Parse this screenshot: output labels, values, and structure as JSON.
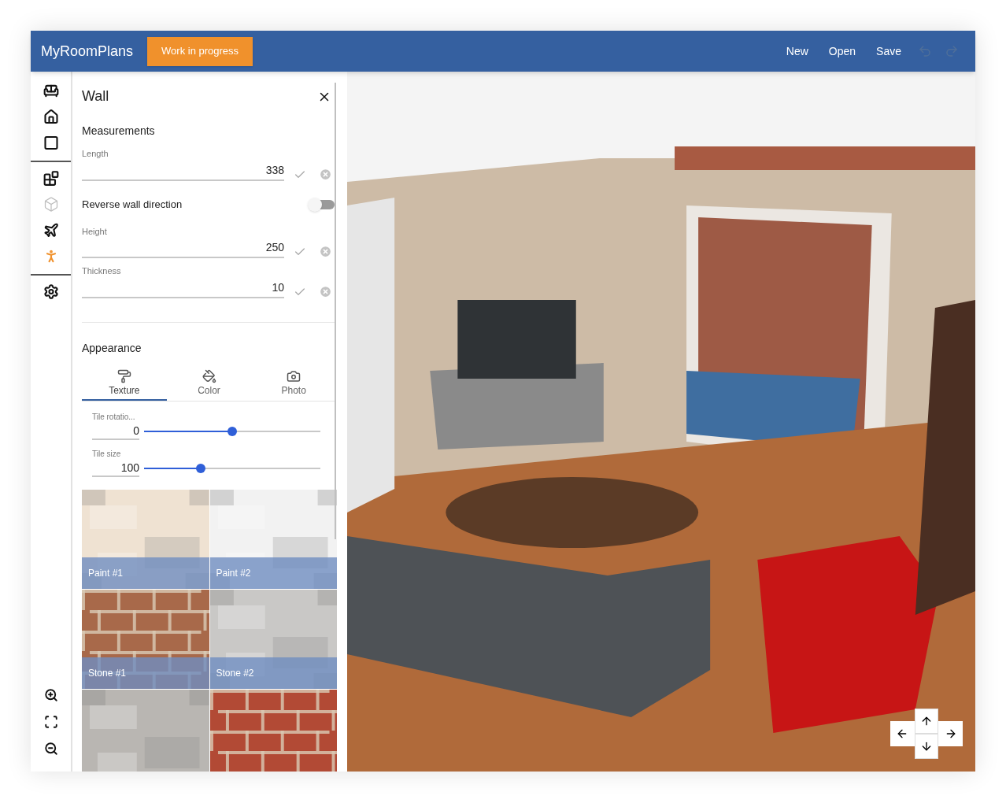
{
  "header": {
    "app_title": "MyRoomPlans",
    "status_badge": "Work in progress",
    "menu": [
      "New",
      "Open",
      "Save"
    ],
    "history": [
      {
        "kind": "undo",
        "disabled": true
      },
      {
        "kind": "redo",
        "disabled": true
      }
    ]
  },
  "rail": {
    "groups": [
      [
        {
          "kind": "sofa",
          "selected": false,
          "disabled": false
        },
        {
          "kind": "home",
          "selected": false,
          "disabled": false
        },
        {
          "kind": "square",
          "selected": false,
          "disabled": false
        }
      ],
      [
        {
          "kind": "blocks",
          "selected": false,
          "disabled": false
        },
        {
          "kind": "cube",
          "selected": false,
          "disabled": true
        },
        {
          "kind": "plane",
          "selected": false,
          "disabled": false
        },
        {
          "kind": "person",
          "selected": true,
          "disabled": false
        }
      ],
      [
        {
          "kind": "settings",
          "selected": false,
          "disabled": false
        }
      ]
    ],
    "zoom": [
      {
        "kind": "zoom-in"
      },
      {
        "kind": "fit"
      },
      {
        "kind": "zoom-out"
      }
    ]
  },
  "panel": {
    "title": "Wall",
    "measurements_heading": "Measurements",
    "fields": [
      {
        "kind": "number",
        "label": "Length",
        "value": "338"
      },
      {
        "kind": "toggle",
        "label": "Reverse wall direction",
        "on": false
      },
      {
        "kind": "number",
        "label": "Height",
        "value": "250"
      },
      {
        "kind": "number",
        "label": "Thickness",
        "value": "10"
      }
    ],
    "appearance_heading": "Appearance",
    "tabs": [
      {
        "kind": "texture",
        "label": "Texture",
        "selected": true
      },
      {
        "kind": "color",
        "label": "Color",
        "selected": false
      },
      {
        "label": "Photo",
        "selected": false
      }
    ],
    "sliders": [
      {
        "label": "Tile rotatio...",
        "value": "0",
        "level": 0.5
      },
      {
        "label": "Tile size",
        "value": "100",
        "level": 0.32
      }
    ],
    "textures": [
      {
        "label": "Paint #1",
        "color": "#efe2d2"
      },
      {
        "label": "Paint #2",
        "color": "#f2f2f2"
      },
      {
        "label": "Stone #1",
        "color": "#a8694a"
      },
      {
        "label": "Stone #2",
        "color": "#c9c8c6"
      },
      {
        "color": "#b9b6b2"
      },
      {
        "color": "#b24a35"
      }
    ]
  }
}
